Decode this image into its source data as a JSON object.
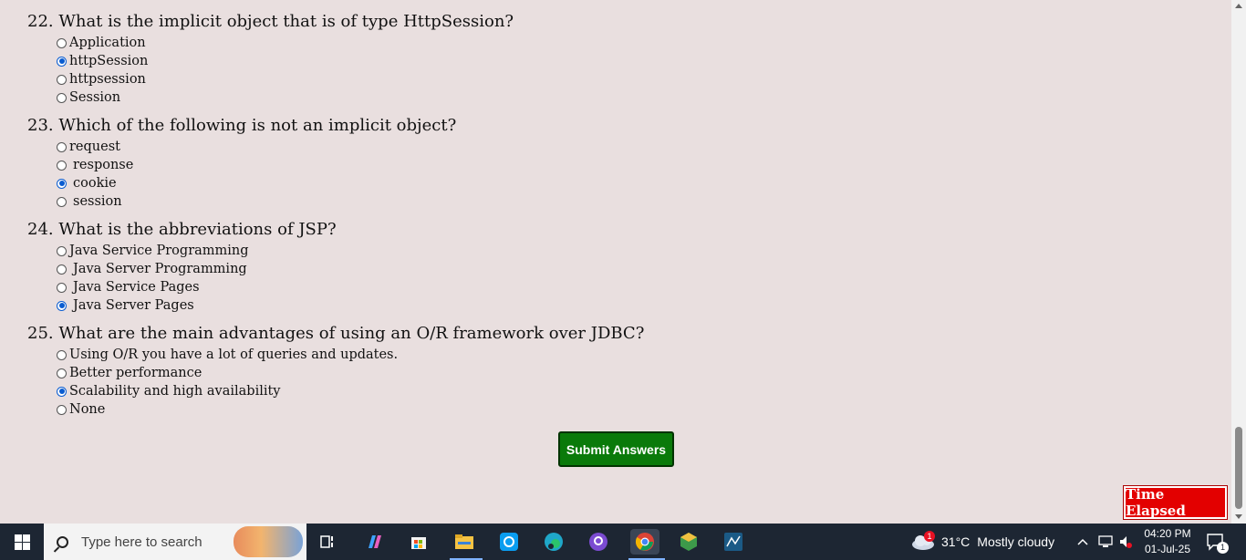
{
  "questions": [
    {
      "title": "22. What is the implicit object that is of type HttpSession?",
      "options": [
        {
          "label": "Application",
          "checked": false
        },
        {
          "label": "httpSession",
          "checked": true
        },
        {
          "label": "httpsession",
          "checked": false
        },
        {
          "label": "Session",
          "checked": false
        }
      ]
    },
    {
      "title": "23. Which of the following is not an implicit object?",
      "options": [
        {
          "label": "request",
          "checked": false
        },
        {
          "label": "response",
          "checked": false
        },
        {
          "label": "cookie",
          "checked": true
        },
        {
          "label": "session",
          "checked": false
        }
      ]
    },
    {
      "title": "24. What is the abbreviations of JSP?",
      "options": [
        {
          "label": "Java Service Programming",
          "checked": false
        },
        {
          "label": "Java Server Programming",
          "checked": false
        },
        {
          "label": "Java Service Pages",
          "checked": false
        },
        {
          "label": "Java Server Pages",
          "checked": true
        }
      ]
    },
    {
      "title": "25. What are the main advantages of using an O/R framework over JDBC?",
      "options": [
        {
          "label": "Using O/R you have a lot of queries and updates.",
          "checked": false
        },
        {
          "label": "Better performance",
          "checked": false
        },
        {
          "label": "Scalability and high availability",
          "checked": true
        },
        {
          "label": "None",
          "checked": false
        }
      ]
    }
  ],
  "submit_label": "Submit Answers",
  "timer_label": "Time Elapsed",
  "taskbar": {
    "search_placeholder": "Type here to search",
    "weather": {
      "temp": "31°C",
      "condition": "Mostly cloudy",
      "badge": "1"
    },
    "clock": {
      "time": "04:20 PM",
      "date": "01-Jul-25"
    },
    "notification_count": "1",
    "pinned_icons": [
      "task-view-icon",
      "copilot-icon",
      "store-icon",
      "file-explorer-icon",
      "sync-app-icon",
      "edge-icon",
      "github-icon",
      "chrome-icon",
      "cube-app-icon",
      "sql-workbench-icon"
    ]
  },
  "colors": {
    "page_bg": "#e9dfdf",
    "submit_bg": "#0a7a0a",
    "timer_bg": "#e30000",
    "taskbar_bg": "#1d2633",
    "radio_checked": "#0a5cd0"
  }
}
